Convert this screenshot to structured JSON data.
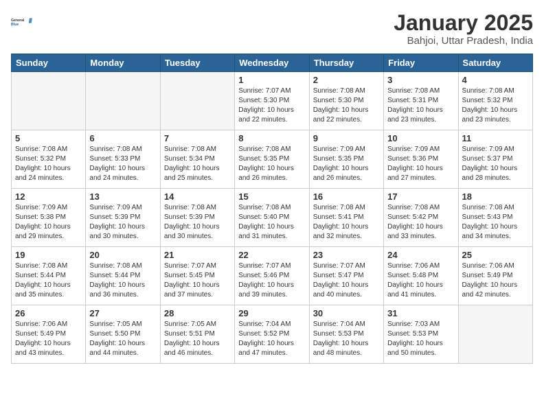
{
  "header": {
    "logo_line1": "General",
    "logo_line2": "Blue",
    "title": "January 2025",
    "subtitle": "Bahjoi, Uttar Pradesh, India"
  },
  "weekdays": [
    "Sunday",
    "Monday",
    "Tuesday",
    "Wednesday",
    "Thursday",
    "Friday",
    "Saturday"
  ],
  "weeks": [
    [
      {
        "day": "",
        "info": ""
      },
      {
        "day": "",
        "info": ""
      },
      {
        "day": "",
        "info": ""
      },
      {
        "day": "1",
        "info": "Sunrise: 7:07 AM\nSunset: 5:30 PM\nDaylight: 10 hours\nand 22 minutes."
      },
      {
        "day": "2",
        "info": "Sunrise: 7:08 AM\nSunset: 5:30 PM\nDaylight: 10 hours\nand 22 minutes."
      },
      {
        "day": "3",
        "info": "Sunrise: 7:08 AM\nSunset: 5:31 PM\nDaylight: 10 hours\nand 23 minutes."
      },
      {
        "day": "4",
        "info": "Sunrise: 7:08 AM\nSunset: 5:32 PM\nDaylight: 10 hours\nand 23 minutes."
      }
    ],
    [
      {
        "day": "5",
        "info": "Sunrise: 7:08 AM\nSunset: 5:32 PM\nDaylight: 10 hours\nand 24 minutes."
      },
      {
        "day": "6",
        "info": "Sunrise: 7:08 AM\nSunset: 5:33 PM\nDaylight: 10 hours\nand 24 minutes."
      },
      {
        "day": "7",
        "info": "Sunrise: 7:08 AM\nSunset: 5:34 PM\nDaylight: 10 hours\nand 25 minutes."
      },
      {
        "day": "8",
        "info": "Sunrise: 7:08 AM\nSunset: 5:35 PM\nDaylight: 10 hours\nand 26 minutes."
      },
      {
        "day": "9",
        "info": "Sunrise: 7:09 AM\nSunset: 5:35 PM\nDaylight: 10 hours\nand 26 minutes."
      },
      {
        "day": "10",
        "info": "Sunrise: 7:09 AM\nSunset: 5:36 PM\nDaylight: 10 hours\nand 27 minutes."
      },
      {
        "day": "11",
        "info": "Sunrise: 7:09 AM\nSunset: 5:37 PM\nDaylight: 10 hours\nand 28 minutes."
      }
    ],
    [
      {
        "day": "12",
        "info": "Sunrise: 7:09 AM\nSunset: 5:38 PM\nDaylight: 10 hours\nand 29 minutes."
      },
      {
        "day": "13",
        "info": "Sunrise: 7:09 AM\nSunset: 5:39 PM\nDaylight: 10 hours\nand 30 minutes."
      },
      {
        "day": "14",
        "info": "Sunrise: 7:08 AM\nSunset: 5:39 PM\nDaylight: 10 hours\nand 30 minutes."
      },
      {
        "day": "15",
        "info": "Sunrise: 7:08 AM\nSunset: 5:40 PM\nDaylight: 10 hours\nand 31 minutes."
      },
      {
        "day": "16",
        "info": "Sunrise: 7:08 AM\nSunset: 5:41 PM\nDaylight: 10 hours\nand 32 minutes."
      },
      {
        "day": "17",
        "info": "Sunrise: 7:08 AM\nSunset: 5:42 PM\nDaylight: 10 hours\nand 33 minutes."
      },
      {
        "day": "18",
        "info": "Sunrise: 7:08 AM\nSunset: 5:43 PM\nDaylight: 10 hours\nand 34 minutes."
      }
    ],
    [
      {
        "day": "19",
        "info": "Sunrise: 7:08 AM\nSunset: 5:44 PM\nDaylight: 10 hours\nand 35 minutes."
      },
      {
        "day": "20",
        "info": "Sunrise: 7:08 AM\nSunset: 5:44 PM\nDaylight: 10 hours\nand 36 minutes."
      },
      {
        "day": "21",
        "info": "Sunrise: 7:07 AM\nSunset: 5:45 PM\nDaylight: 10 hours\nand 37 minutes."
      },
      {
        "day": "22",
        "info": "Sunrise: 7:07 AM\nSunset: 5:46 PM\nDaylight: 10 hours\nand 39 minutes."
      },
      {
        "day": "23",
        "info": "Sunrise: 7:07 AM\nSunset: 5:47 PM\nDaylight: 10 hours\nand 40 minutes."
      },
      {
        "day": "24",
        "info": "Sunrise: 7:06 AM\nSunset: 5:48 PM\nDaylight: 10 hours\nand 41 minutes."
      },
      {
        "day": "25",
        "info": "Sunrise: 7:06 AM\nSunset: 5:49 PM\nDaylight: 10 hours\nand 42 minutes."
      }
    ],
    [
      {
        "day": "26",
        "info": "Sunrise: 7:06 AM\nSunset: 5:49 PM\nDaylight: 10 hours\nand 43 minutes."
      },
      {
        "day": "27",
        "info": "Sunrise: 7:05 AM\nSunset: 5:50 PM\nDaylight: 10 hours\nand 44 minutes."
      },
      {
        "day": "28",
        "info": "Sunrise: 7:05 AM\nSunset: 5:51 PM\nDaylight: 10 hours\nand 46 minutes."
      },
      {
        "day": "29",
        "info": "Sunrise: 7:04 AM\nSunset: 5:52 PM\nDaylight: 10 hours\nand 47 minutes."
      },
      {
        "day": "30",
        "info": "Sunrise: 7:04 AM\nSunset: 5:53 PM\nDaylight: 10 hours\nand 48 minutes."
      },
      {
        "day": "31",
        "info": "Sunrise: 7:03 AM\nSunset: 5:53 PM\nDaylight: 10 hours\nand 50 minutes."
      },
      {
        "day": "",
        "info": ""
      }
    ]
  ]
}
